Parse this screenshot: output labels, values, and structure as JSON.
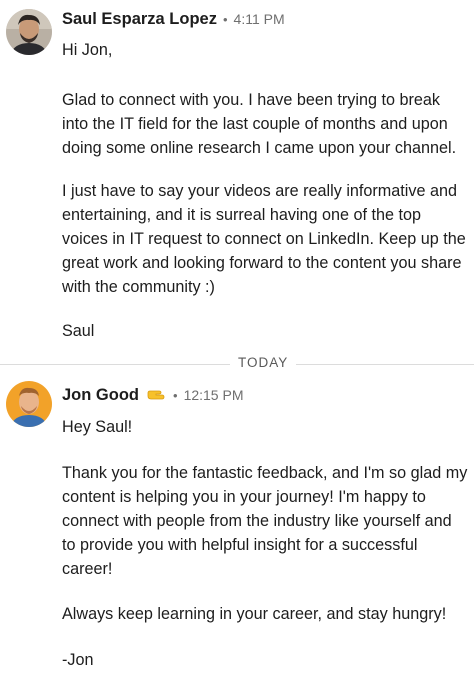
{
  "messages": [
    {
      "sender": "Saul Esparza Lopez",
      "time": "4:11 PM",
      "lines": [
        "Hi Jon,",
        "Glad to connect with you. I have been trying to break",
        "into the IT field for the last couple of months and upon",
        "doing some online research I came upon your channel.",
        "I just have to say your videos are really informative and",
        "entertaining, and it is surreal having one of the top",
        "voices in IT request to connect on LinkedIn. Keep up the",
        "great work and looking forward to the content you share",
        "with the community :)",
        "Saul"
      ]
    },
    {
      "sender": "Jon Good",
      "time": "12:15 PM",
      "lines": [
        "Hey Saul!",
        "Thank you for the fantastic feedback, and I'm so glad my",
        "content is helping you in your journey! I'm happy to",
        "connect with people from the industry like yourself and",
        "to provide you with helpful insight for a successful",
        "career!",
        "Always keep learning in your career, and stay hungry!",
        "-Jon"
      ]
    }
  ],
  "divider_label": "TODAY",
  "icons": {
    "dot": "•",
    "pointing_hand": "pointing-hand-emoji"
  },
  "colors": {
    "meta_gray": "#6f6f6f",
    "divider": "#dcdcdc",
    "text": "#1d1d1d"
  }
}
